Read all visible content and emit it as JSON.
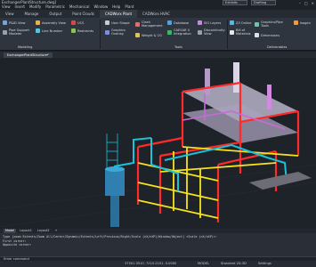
{
  "document": {
    "title": "ExchangerPlantStructure.dwg]"
  },
  "menu": [
    "View",
    "Insert",
    "Modify",
    "Parametric",
    "Mechanical",
    "Window",
    "Help",
    "Plant"
  ],
  "quick_access": {
    "workspace": "Exhibits",
    "tool": "Drafting"
  },
  "ribbon_tabs": [
    {
      "label": "View"
    },
    {
      "label": "Manage"
    },
    {
      "label": "Output"
    },
    {
      "label": "Point Clouds"
    },
    {
      "label": "CADWorx Plant",
      "active": true
    },
    {
      "label": "CADWorx HVAC"
    }
  ],
  "ribbon": {
    "p_id_view": "P&ID View",
    "pipe_support": "Pipe Support\nModeler",
    "assembly_view": "Assembly View",
    "line_number": "Line Number",
    "ucs": "UCS",
    "restraints": "Restraints",
    "user_shape": "User Shape",
    "graphics_overlay": "Graphics\nOverlay",
    "clash_management": "Clash\nManagement",
    "weight_cg": "Weight & CG",
    "database": "Database",
    "caesar": "CAESAR II\nIntegration",
    "iso_layers": "ISO Layers",
    "discontinuity_view": "Discontinuity\nView",
    "z_off_online": "Z/I Online",
    "bill_of_materials": "Bill of\nMaterials",
    "graphics_pipe_tools": "Graphics/Pipe\nTools",
    "dimensions": "Dimensions",
    "isogen": "Isogen",
    "group_modeling": "Modeling",
    "group_tools": "Tools",
    "group_deliverables": "Deliverables"
  },
  "file_tab": "ExchangerPlantStructure*",
  "layout_tabs": [
    {
      "label": "Model",
      "active": true
    },
    {
      "label": "Layout1"
    },
    {
      "label": "Layout2"
    },
    {
      "label": "+"
    }
  ],
  "command_history": [
    "Type [zoom Extents/Zoom All/Center/Dynamic/Extents/Left/Previous/Right/Scale (nX/nXP)/Window/Object] <Scale (nX/nXP)>:",
    "First corner:",
    "Opposite corner:"
  ],
  "command_prompt": "Enter command",
  "status": {
    "coords": "37501.3510, 7210.2101, 0.0000",
    "model": "MODEL",
    "standard": "Standard 2D-3D",
    "settings": "Settings"
  },
  "colors": {
    "background": "#1e2229",
    "steel_red": "#ff2a2a",
    "steel_yellow": "#f6e31c",
    "pipe_cyan": "#17c4d8",
    "pipe_magenta": "#c86ad8",
    "platform_grey": "#b9b3c9"
  }
}
